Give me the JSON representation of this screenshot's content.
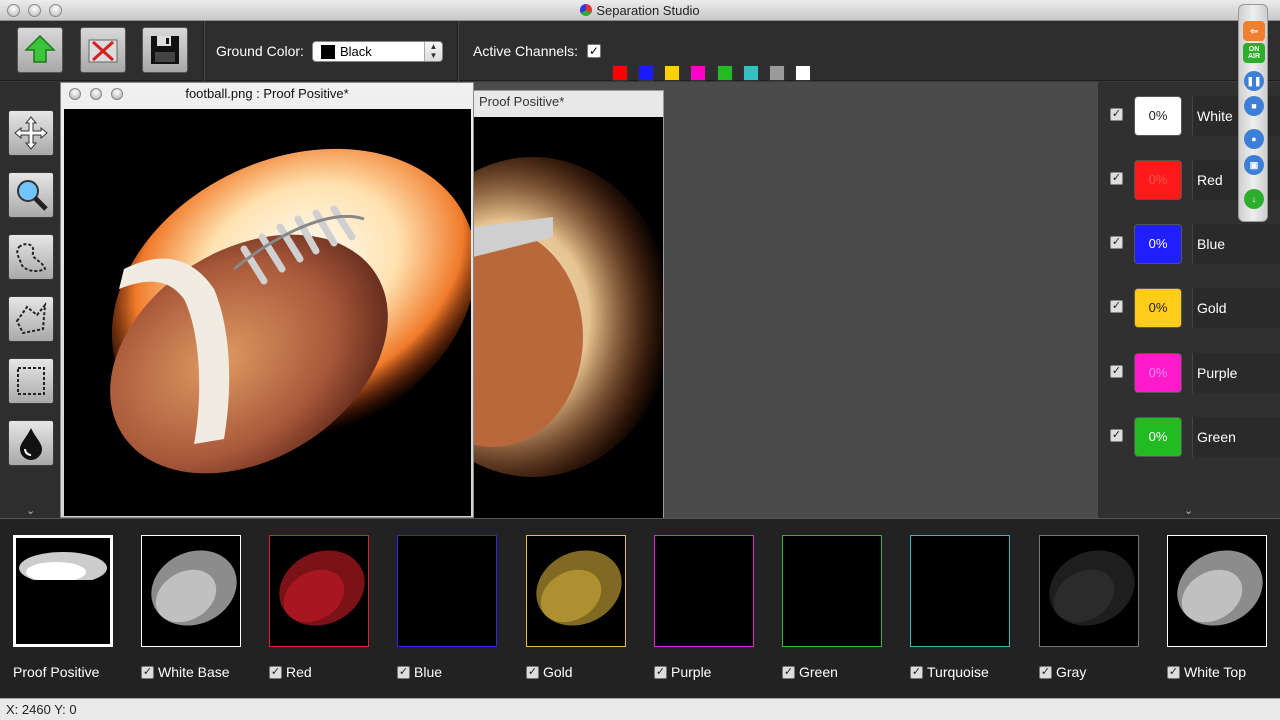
{
  "window": {
    "title": "Separation Studio"
  },
  "toolbar": {
    "ground_color_label": "Ground Color:",
    "ground_color_value": "Black",
    "active_channels_label": "Active Channels:",
    "channel_swatches": [
      "#ff0000",
      "#1a1aff",
      "#ffd000",
      "#ff00cc",
      "#22bb22",
      "#33c0c0",
      "#9a9a9a",
      "#ffffff"
    ]
  },
  "doc_window": {
    "title": "football.png : Proof Positive*"
  },
  "doc_window_back": {
    "title": "Proof Positive*"
  },
  "channels_panel": [
    {
      "name": "White",
      "pct": "0%",
      "color": "#ffffff",
      "text": "#222222"
    },
    {
      "name": "Red",
      "pct": "0%",
      "color": "#ff1a1a",
      "text": "#ff5555"
    },
    {
      "name": "Blue",
      "pct": "0%",
      "color": "#1f1fff",
      "text": "#ffffff"
    },
    {
      "name": "Gold",
      "pct": "0%",
      "color": "#ffcc1a",
      "text": "#222222"
    },
    {
      "name": "Purple",
      "pct": "0%",
      "color": "#ff1acc",
      "text": "#ff88ee"
    },
    {
      "name": "Green",
      "pct": "0%",
      "color": "#22bb22",
      "text": "#ffffff"
    }
  ],
  "thumbnails": [
    {
      "label": "Proof Positive",
      "checked": false,
      "border": "#ffffff"
    },
    {
      "label": "White Base",
      "checked": true,
      "border": "#ffffff"
    },
    {
      "label": "Red",
      "checked": true,
      "border": "#e0202a"
    },
    {
      "label": "Blue",
      "checked": true,
      "border": "#2a2ae0"
    },
    {
      "label": "Gold",
      "checked": true,
      "border": "#e8c040"
    },
    {
      "label": "Purple",
      "checked": true,
      "border": "#e02ad0"
    },
    {
      "label": "Green",
      "checked": true,
      "border": "#2abb2a"
    },
    {
      "label": "Turquoise",
      "checked": true,
      "border": "#33bbbb"
    },
    {
      "label": "Gray",
      "checked": true,
      "border": "#777777"
    },
    {
      "label": "White Top",
      "checked": true,
      "border": "#ffffff"
    }
  ],
  "status": {
    "coords": "X: 2460 Y: 0"
  },
  "floating_palette": {
    "on_air": "ON AIR"
  }
}
